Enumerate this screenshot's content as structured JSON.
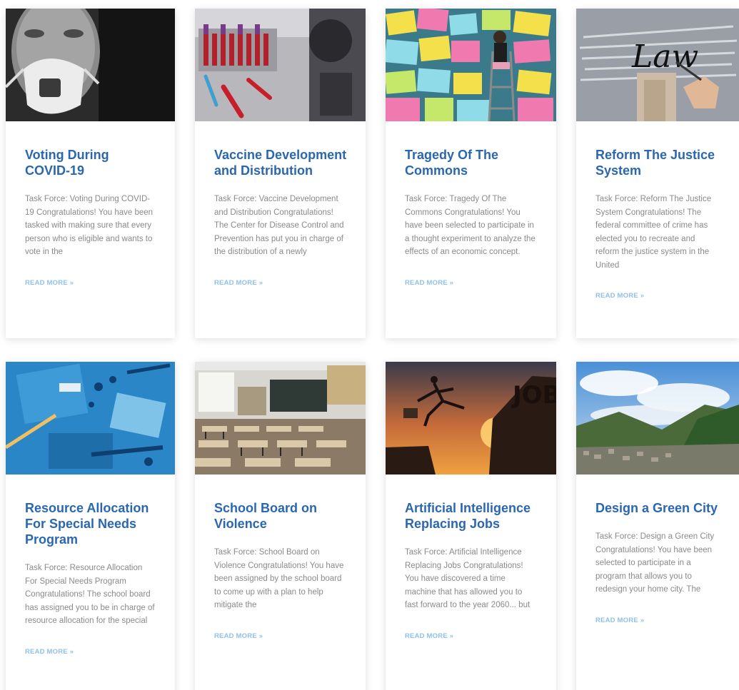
{
  "cards": [
    {
      "title": "Voting During COVID-19",
      "excerpt": "Task Force: Voting During COVID-19 Congratulations! You have been tasked with making sure that every person who is eligible and wants to vote in the",
      "link": "READ MORE »",
      "image": "person-wearing-mask"
    },
    {
      "title": "Vaccine Development and Distribution",
      "excerpt": "Task Force: Vaccine Development and Distribution Congratulations! The Center for Disease Control and Prevention has put you in charge of the distribution of a newly",
      "link": "READ MORE »",
      "image": "lab-test-tubes-microscope"
    },
    {
      "title": "Tragedy Of The Commons",
      "excerpt": "Task Force: Tragedy Of The Commons Congratulations! You have been selected to participate in a thought experiment to analyze the effects of an economic concept.",
      "link": "READ MORE »",
      "image": "sticky-notes-wall"
    },
    {
      "title": "Reform The Justice System",
      "excerpt": "Task Force: Reform The Justice System Congratulations! The federal committee of crime has elected you to recreate and reform the justice system in the United",
      "link": "READ MORE »",
      "image": "law-writing",
      "image_text": "Law"
    },
    {
      "title": "Resource Allocation For Special Needs Program",
      "excerpt": "Task Force: Resource Allocation For Special Needs Program Congratulations! The school board has assigned you to be in charge of resource allocation for the special",
      "link": "READ MORE »",
      "image": "blue-supplies-flatlay"
    },
    {
      "title": "School Board on Violence",
      "excerpt": "Task Force: School Board on Violence Congratulations! You have been assigned by the school board to come up with a plan to help mitigate the",
      "link": "READ MORE »",
      "image": "empty-classroom"
    },
    {
      "title": "Artificial Intelligence Replacing Jobs",
      "excerpt": "Task Force: Artificial Intelligence Replacing Jobs Congratulations! You have discovered a time machine that has allowed you to fast forward to the year 2060... but",
      "link": "READ MORE »",
      "image": "jump-to-job-sunset",
      "image_text": "JOB"
    },
    {
      "title": "Design a Green City",
      "excerpt": "Task Force: Design a Green City Congratulations! You have been selected to participate in a program that allows you to redesign your home city. The",
      "link": "READ MORE »",
      "image": "city-valley-landscape"
    }
  ],
  "colors": {
    "title": "#2a67b0",
    "excerpt": "#8a8a8a",
    "link": "#8fc1e8"
  }
}
